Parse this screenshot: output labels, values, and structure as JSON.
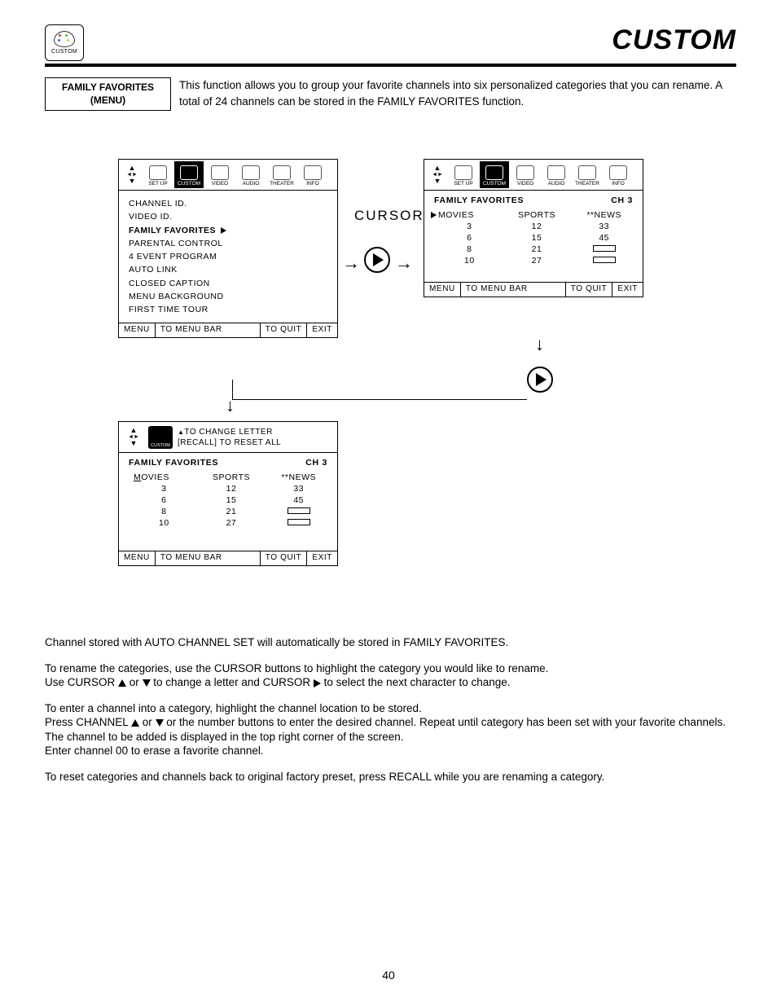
{
  "header": {
    "icon_label": "CUSTOM",
    "page_title": "CUSTOM"
  },
  "intro": {
    "label_line1": "FAMILY FAVORITES",
    "label_line2": "(MENU)",
    "text": "This function allows you to group your favorite channels into six personalized categories that you can rename. A total of 24 channels can be stored in the FAMILY FAVORITES function."
  },
  "tabs": [
    "SET UP",
    "CUSTOM",
    "VIDEO",
    "AUDIO",
    "THEATER",
    "INFO"
  ],
  "menu_items": [
    "CHANNEL ID.",
    "VIDEO ID.",
    "FAMILY FAVORITES",
    "PARENTAL CONTROL",
    "4 EVENT PROGRAM",
    "AUTO LINK",
    "CLOSED CAPTION",
    "MENU BACKGROUND",
    "FIRST TIME TOUR"
  ],
  "footer": {
    "menu": "MENU",
    "to_menu_bar": "TO MENU BAR",
    "to_quit": "TO QUIT",
    "exit": "EXIT"
  },
  "cursor_label": "CURSOR",
  "fav": {
    "title": "FAMILY FAVORITES",
    "ch_label": "CH  3",
    "cats": [
      "MOVIES",
      "SPORTS",
      "**NEWS"
    ],
    "cols": [
      [
        "3",
        "6",
        "8",
        "10"
      ],
      [
        "12",
        "15",
        "21",
        "27"
      ],
      [
        "33",
        "45",
        "",
        ""
      ]
    ]
  },
  "mini": {
    "line1": "TO CHANGE LETTER",
    "line2": "[RECALL] TO RESET ALL",
    "custom": "CUSTOM"
  },
  "body": {
    "p1": "Channel stored with AUTO CHANNEL SET will automatically be stored in FAMILY FAVORITES.",
    "p2a": "To rename the categories, use the CURSOR buttons to highlight the category you would like to rename.",
    "p2b_pre": "Use CURSOR ",
    "p2b_mid": " or ",
    "p2b_mid2": " to change a letter and CURSOR ",
    "p2b_end": " to select the next character to change.",
    "p3": "To enter a channel into a category, highlight the channel location to be stored.",
    "p4_pre": "Press CHANNEL ",
    "p4_mid": " or ",
    "p4_end": " or the number buttons to enter the desired channel.  Repeat until category has been set with your favorite channels.  The channel to be added is displayed in the top right corner of the screen.",
    "p5": "Enter channel 00 to erase a favorite channel.",
    "p6": "To reset categories and channels back to original factory preset, press RECALL while you are renaming a category."
  },
  "page_number": "40"
}
